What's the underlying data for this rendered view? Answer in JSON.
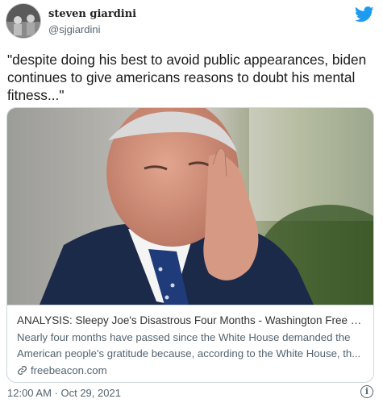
{
  "tweet": {
    "author_name": "steven giardini",
    "author_handle": "@sjgiardini",
    "text": "\"despite doing his best to avoid public appearances, biden continues to give americans reasons to doubt his mental fitness...\"",
    "timestamp": "12:00 AM · Oct 29, 2021",
    "info_glyph": "i"
  },
  "card": {
    "title": "ANALYSIS: Sleepy Joe's Disastrous Four Months - Washington Free Beac...",
    "description": "Nearly four months have passed since the White House demanded the American people's gratitude because, according to the White House, th...",
    "domain": "freebeacon.com",
    "image_alt": "photo of a man in a suit touching his temple"
  },
  "icons": {
    "brand": "twitter-bird-icon",
    "link": "link-icon",
    "info": "info-icon"
  },
  "colors": {
    "twitter_blue": "#1d9bf0",
    "secondary_text": "#536471",
    "card_border": "#cfd9de"
  }
}
